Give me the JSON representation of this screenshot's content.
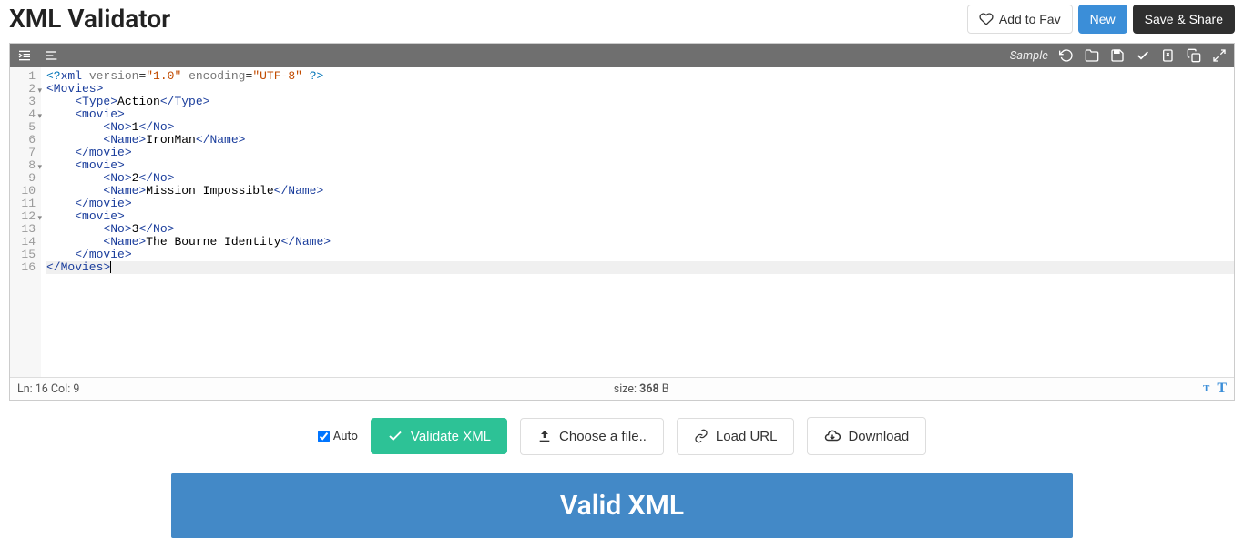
{
  "header": {
    "title": "XML Validator",
    "fav_label": "Add to Fav",
    "new_label": "New",
    "save_label": "Save & Share"
  },
  "toolbar": {
    "sample_label": "Sample"
  },
  "code": {
    "lines": [
      {
        "n": 1,
        "indent": 0,
        "fold": false,
        "segs": [
          {
            "c": "t-decl",
            "t": "<?"
          },
          {
            "c": "t-tag",
            "t": "xml"
          },
          {
            "c": "",
            "t": " "
          },
          {
            "c": "t-attr",
            "t": "version"
          },
          {
            "c": "",
            "t": "="
          },
          {
            "c": "t-str",
            "t": "\"1.0\""
          },
          {
            "c": "",
            "t": " "
          },
          {
            "c": "t-attr",
            "t": "encoding"
          },
          {
            "c": "",
            "t": "="
          },
          {
            "c": "t-str",
            "t": "\"UTF-8\""
          },
          {
            "c": "",
            "t": " "
          },
          {
            "c": "t-decl",
            "t": "?>"
          }
        ]
      },
      {
        "n": 2,
        "indent": 0,
        "fold": true,
        "segs": [
          {
            "c": "t-tag",
            "t": "<Movies>"
          }
        ]
      },
      {
        "n": 3,
        "indent": 1,
        "fold": false,
        "segs": [
          {
            "c": "t-tag",
            "t": "<Type>"
          },
          {
            "c": "t-text",
            "t": "Action"
          },
          {
            "c": "t-tag",
            "t": "</Type>"
          }
        ]
      },
      {
        "n": 4,
        "indent": 1,
        "fold": true,
        "segs": [
          {
            "c": "t-tag",
            "t": "<movie>"
          }
        ]
      },
      {
        "n": 5,
        "indent": 2,
        "fold": false,
        "segs": [
          {
            "c": "t-tag",
            "t": "<No>"
          },
          {
            "c": "t-text",
            "t": "1"
          },
          {
            "c": "t-tag",
            "t": "</No>"
          }
        ]
      },
      {
        "n": 6,
        "indent": 2,
        "fold": false,
        "segs": [
          {
            "c": "t-tag",
            "t": "<Name>"
          },
          {
            "c": "t-text",
            "t": "IronMan"
          },
          {
            "c": "t-tag",
            "t": "</Name>"
          }
        ]
      },
      {
        "n": 7,
        "indent": 1,
        "fold": false,
        "segs": [
          {
            "c": "t-tag",
            "t": "</movie>"
          }
        ]
      },
      {
        "n": 8,
        "indent": 1,
        "fold": true,
        "segs": [
          {
            "c": "t-tag",
            "t": "<movie>"
          }
        ]
      },
      {
        "n": 9,
        "indent": 2,
        "fold": false,
        "segs": [
          {
            "c": "t-tag",
            "t": "<No>"
          },
          {
            "c": "t-text",
            "t": "2"
          },
          {
            "c": "t-tag",
            "t": "</No>"
          }
        ]
      },
      {
        "n": 10,
        "indent": 2,
        "fold": false,
        "segs": [
          {
            "c": "t-tag",
            "t": "<Name>"
          },
          {
            "c": "t-text",
            "t": "Mission Impossible"
          },
          {
            "c": "t-tag",
            "t": "</Name>"
          }
        ]
      },
      {
        "n": 11,
        "indent": 1,
        "fold": false,
        "segs": [
          {
            "c": "t-tag",
            "t": "</movie>"
          }
        ]
      },
      {
        "n": 12,
        "indent": 1,
        "fold": true,
        "segs": [
          {
            "c": "t-tag",
            "t": "<movie>"
          }
        ]
      },
      {
        "n": 13,
        "indent": 2,
        "fold": false,
        "segs": [
          {
            "c": "t-tag",
            "t": "<No>"
          },
          {
            "c": "t-text",
            "t": "3"
          },
          {
            "c": "t-tag",
            "t": "</No>"
          }
        ]
      },
      {
        "n": 14,
        "indent": 2,
        "fold": false,
        "segs": [
          {
            "c": "t-tag",
            "t": "<Name>"
          },
          {
            "c": "t-text",
            "t": "The Bourne Identity"
          },
          {
            "c": "t-tag",
            "t": "</Name>"
          }
        ]
      },
      {
        "n": 15,
        "indent": 1,
        "fold": false,
        "segs": [
          {
            "c": "t-tag",
            "t": "</movie>"
          }
        ]
      },
      {
        "n": 16,
        "indent": 0,
        "fold": false,
        "hl": true,
        "cursor": true,
        "segs": [
          {
            "c": "t-tag",
            "t": "</Movies>"
          }
        ]
      }
    ]
  },
  "status": {
    "pos": "Ln: 16 Col: 9",
    "size_prefix": "size: ",
    "size_val": "368",
    "size_suffix": " B"
  },
  "actions": {
    "auto_label": "Auto",
    "validate_label": "Validate XML",
    "choose_label": "Choose a file..",
    "loadurl_label": "Load URL",
    "download_label": "Download"
  },
  "result": {
    "text": "Valid XML"
  }
}
